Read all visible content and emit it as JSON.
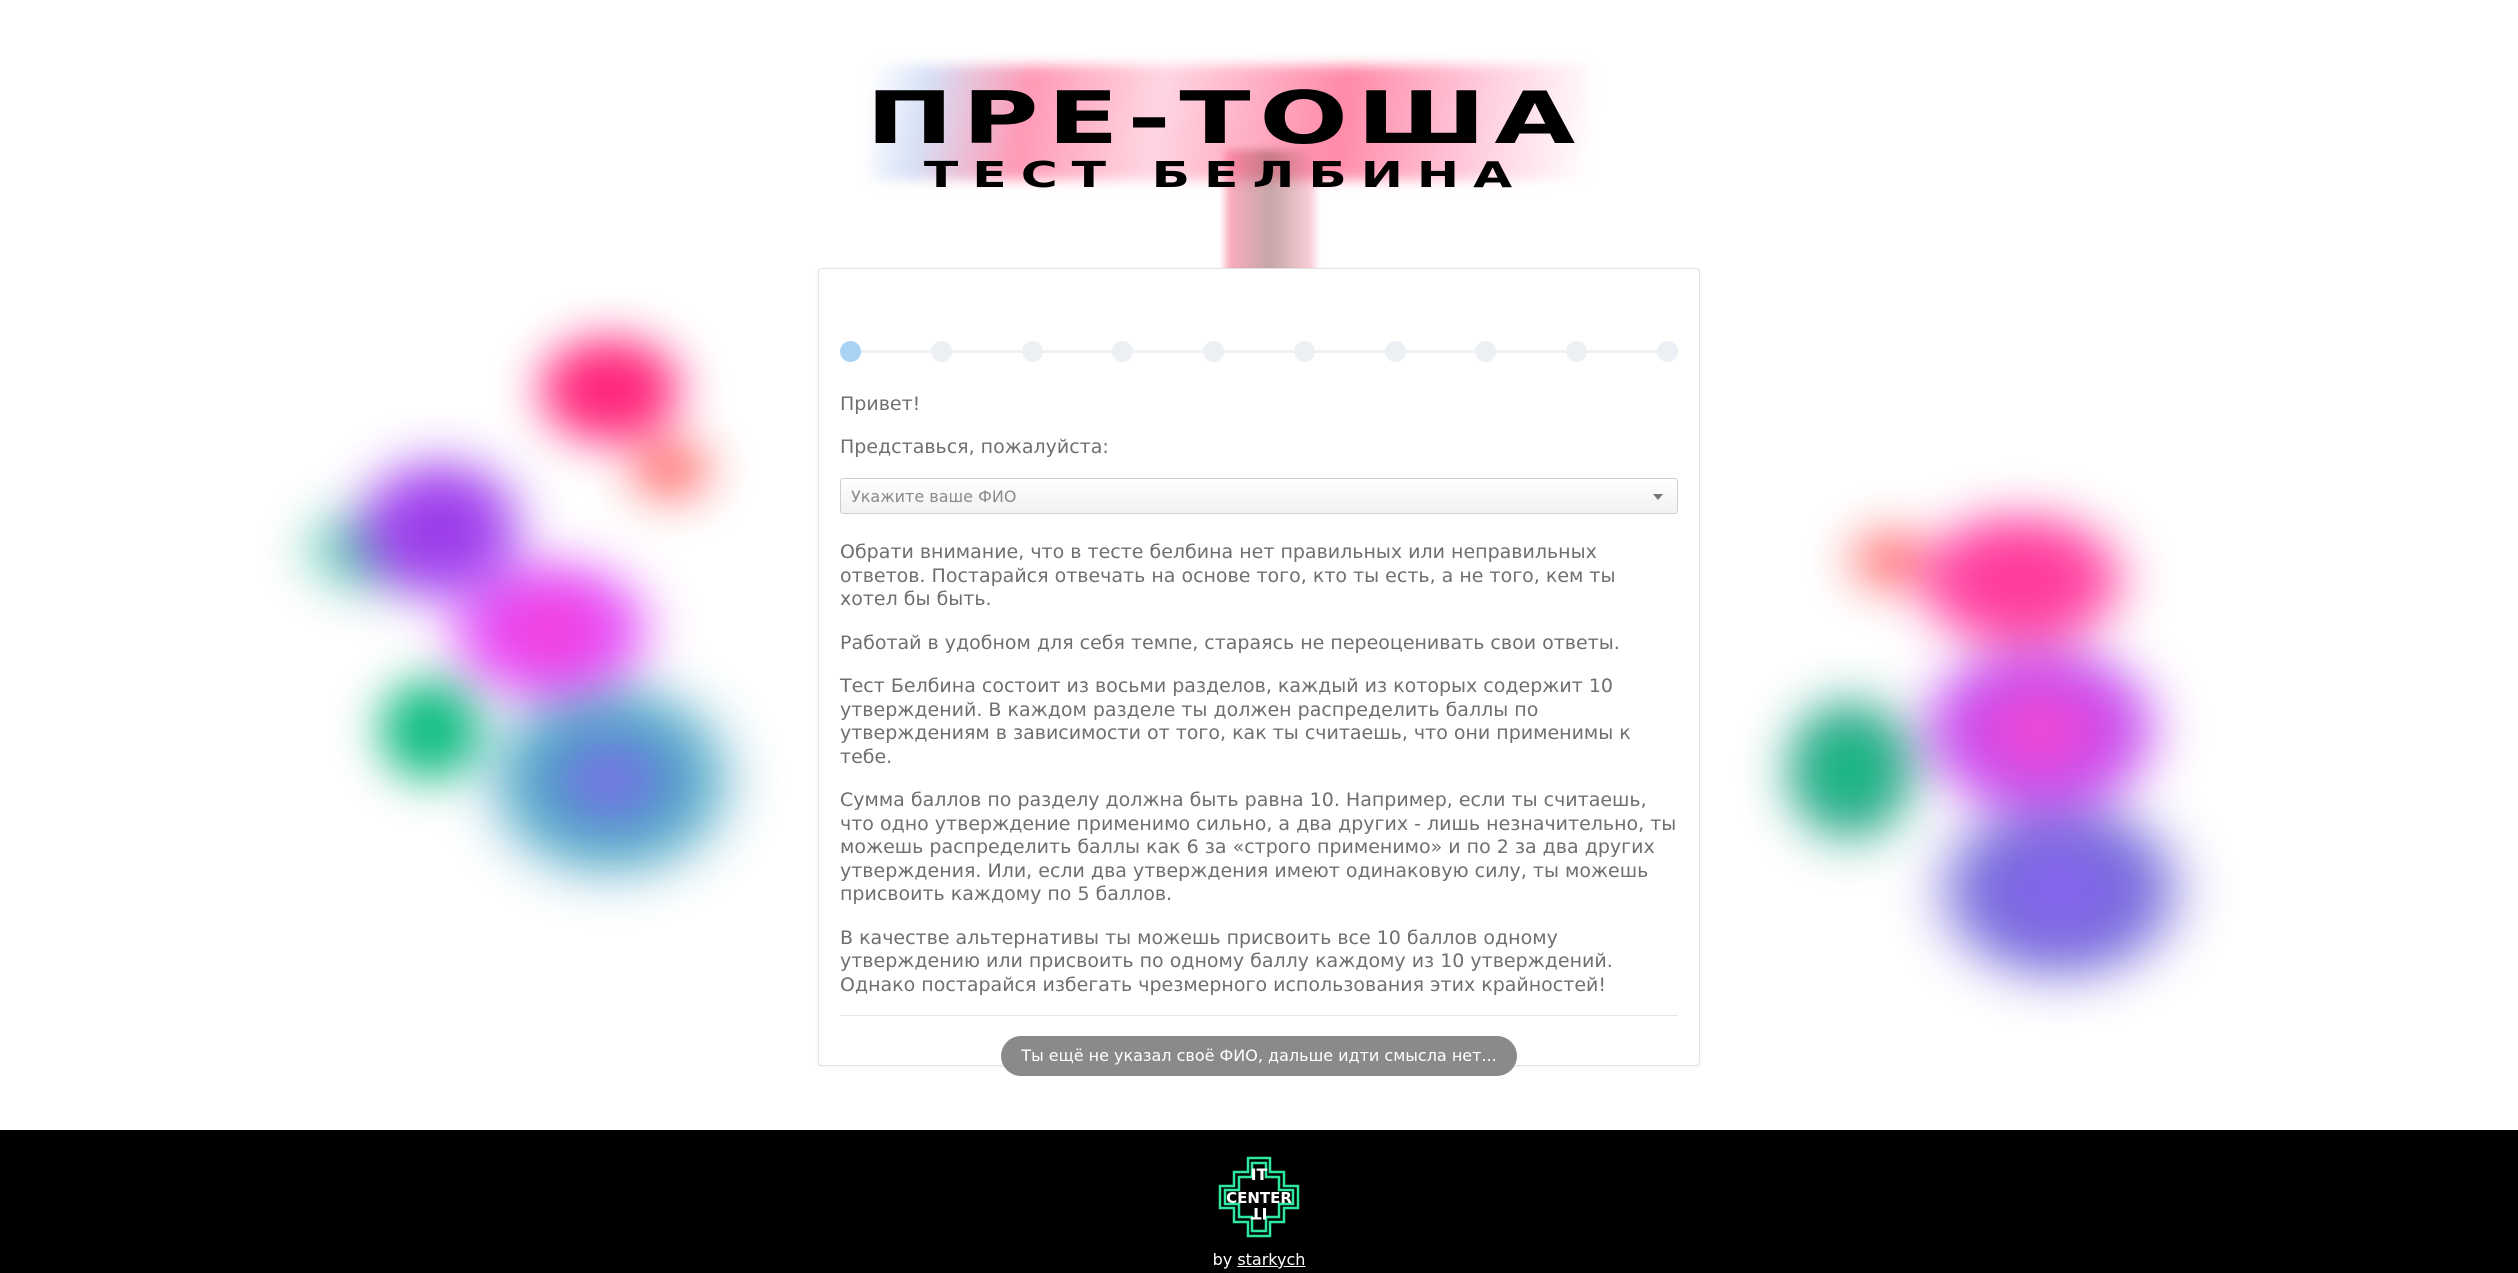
{
  "logo": {
    "title": "ПРЕ-ТОША",
    "subtitle": "ТЕСТ БЕЛБИНА"
  },
  "stepper": {
    "total_steps": 10,
    "current_step": 1
  },
  "form": {
    "greeting": "Привет!",
    "introduce_prompt": "Представься, пожалуйста:",
    "name_select_placeholder": "Укажите ваше ФИО",
    "paragraphs": [
      "Обрати внимание, что в тесте белбина нет правильных или неправильных ответов. Постарайся отвечать на основе того, кто ты есть, а не того, кем ты хотел бы быть.",
      "Работай в удобном для себя темпе, стараясь не переоценивать свои ответы.",
      "Тест Белбина состоит из восьми разделов, каждый из которых содержит 10 утверждений. В каждом разделе ты должен распределить баллы по утверждениям в зависимости от того, как ты считаешь, что они применимы к тебе.",
      "Сумма баллов по разделу должна быть равна 10. Например, если ты считаешь, что одно утверждение применимо сильно, а два других - лишь незначительно, ты можешь распределить баллы как 6 за «строго применимо» и по 2 за два других утверждения. Или, если два утверждения имеют одинаковую силу, ты можешь присвоить каждому по 5 баллов.",
      "В качестве альтернативы ты можешь присвоить все 10 баллов одному утверждению или присвоить по одному баллу каждому из 10 утверждений. Однако постарайся избегать чрезмерного использования этих крайностей!"
    ],
    "next_button_label": "Ты ещё не указал своё ФИО, дальше идти смысла нет..."
  },
  "footer": {
    "logo_text_top": "IT",
    "logo_text_bottom": "CENTER",
    "credit_prefix": "by ",
    "credit_author": "starkych"
  },
  "colors": {
    "accent_step": "#a9d2f3",
    "button_bg": "#8a8a8a",
    "footer_bg": "#000000",
    "logo_green": "#2ee8a0"
  }
}
